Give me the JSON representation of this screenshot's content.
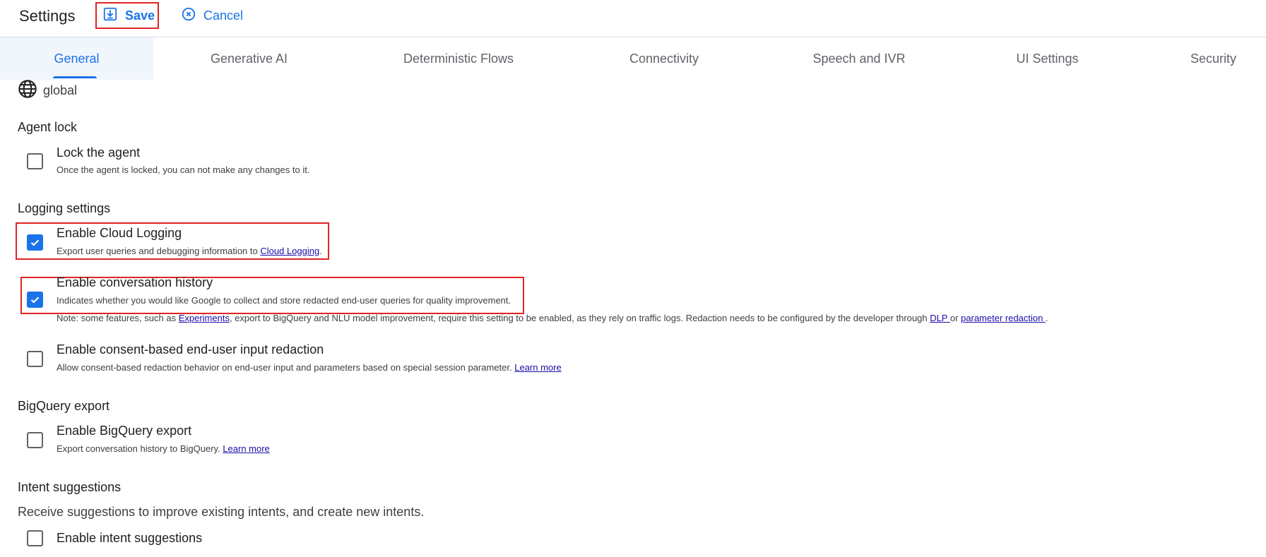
{
  "header": {
    "title": "Settings",
    "save_label": "Save",
    "cancel_label": "Cancel"
  },
  "tabs": [
    {
      "label": "General",
      "active": true
    },
    {
      "label": "Generative AI"
    },
    {
      "label": "Deterministic Flows"
    },
    {
      "label": "Connectivity"
    },
    {
      "label": "Speech and IVR"
    },
    {
      "label": "UI Settings"
    },
    {
      "label": "Security"
    }
  ],
  "region": {
    "icon": "globe-icon",
    "label": "global"
  },
  "agent_lock": {
    "title": "Agent lock",
    "lock": {
      "label": "Lock the agent",
      "desc": "Once the agent is locked, you can not make any changes to it.",
      "checked": false
    }
  },
  "logging": {
    "title": "Logging settings",
    "cloud_logging": {
      "label": "Enable Cloud Logging",
      "desc_prefix": "Export user queries and debugging information to ",
      "desc_link": "Cloud Logging",
      "desc_suffix": ".",
      "checked": true
    },
    "conversation_history": {
      "label": "Enable conversation history",
      "desc": "Indicates whether you would like Google to collect and store redacted end-user queries for quality improvement.",
      "note_prefix": "Note: some features, such as ",
      "note_link1": "Experiments",
      "note_middle": ", export to BigQuery and NLU model improvement, require this setting to be enabled, as they rely on traffic logs. Redaction needs to be configured by the developer through ",
      "note_link2": "DLP ",
      "note_or": "or ",
      "note_link3": "parameter redaction ",
      "note_suffix": ".",
      "checked": true
    },
    "consent_redaction": {
      "label": "Enable consent-based end-user input redaction",
      "desc_prefix": "Allow consent-based redaction behavior on end-user input and parameters based on special session parameter. ",
      "desc_link": "Learn more",
      "checked": false
    }
  },
  "bigquery": {
    "title": "BigQuery export",
    "export": {
      "label": "Enable BigQuery export",
      "desc_prefix": "Export conversation history to BigQuery. ",
      "desc_link": "Learn more",
      "checked": false
    }
  },
  "intent_suggestions": {
    "title": "Intent suggestions",
    "desc": "Receive suggestions to improve existing intents, and create new intents.",
    "enable": {
      "label": "Enable intent suggestions",
      "checked": false
    }
  },
  "colors": {
    "accent": "#1a73e8",
    "highlight": "#e02424",
    "link": "#1a0dab"
  }
}
